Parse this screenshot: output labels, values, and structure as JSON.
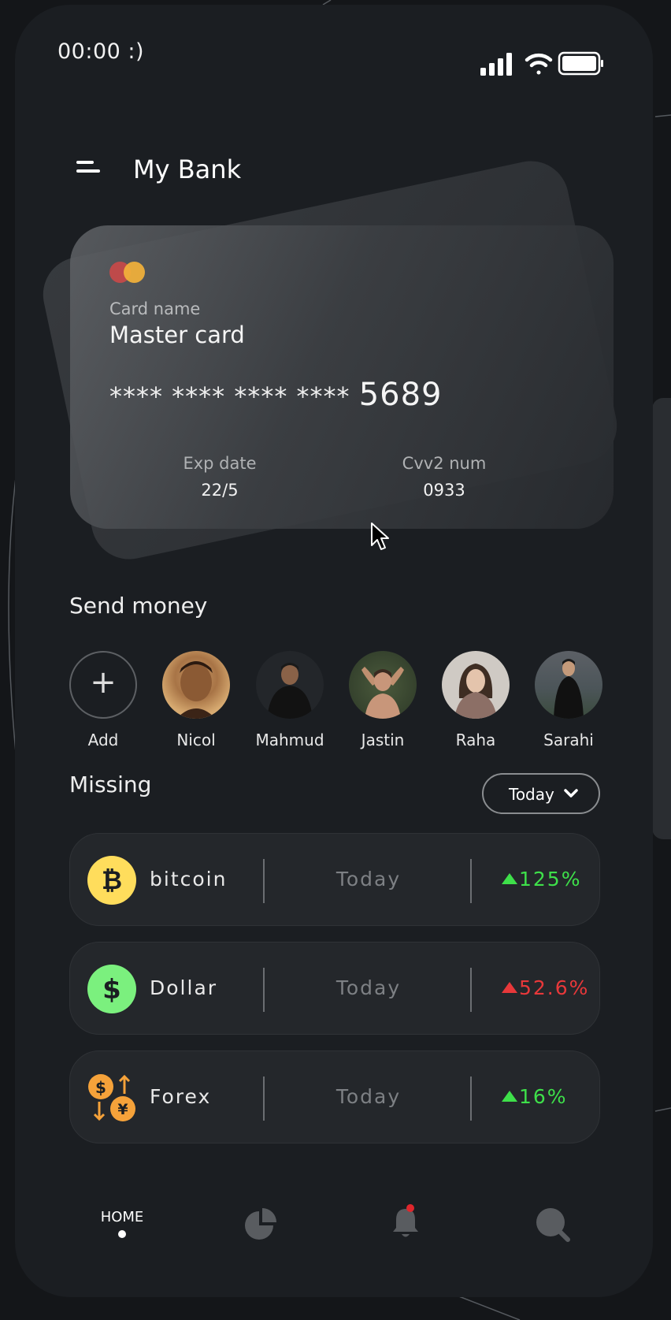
{
  "status_bar": {
    "time": "00:00 :)",
    "signal_icon": "signal-bars-icon",
    "wifi_icon": "wifi-icon",
    "battery_icon": "battery-full-icon"
  },
  "header": {
    "menu_icon": "menu-icon",
    "title": "My Bank"
  },
  "card": {
    "brand_icon": "mastercard-logo",
    "name_label": "Card name",
    "name_value": "Master card",
    "number_masked": "**** **** **** ****",
    "number_last4": "5689",
    "exp_label": "Exp date",
    "exp_value": "22/5",
    "cvv_label": "Cvv2 num",
    "cvv_value": "0933"
  },
  "send_money": {
    "title": "Send money",
    "contacts": [
      {
        "name": "Add",
        "icon": "plus-icon"
      },
      {
        "name": "Nicol"
      },
      {
        "name": "Mahmud"
      },
      {
        "name": "Jastin"
      },
      {
        "name": "Raha"
      },
      {
        "name": "Sarahi"
      }
    ]
  },
  "missing": {
    "title": "Missing",
    "filter_label": "Today",
    "rows": [
      {
        "name": "bitcoin",
        "icon": "bitcoin-icon",
        "period": "Today",
        "change": "125%",
        "color": "#3ee04a"
      },
      {
        "name": "Dollar",
        "icon": "dollar-icon",
        "period": "Today",
        "change": "52.6%",
        "color": "#e8383a"
      },
      {
        "name": "Forex",
        "icon": "forex-exchange-icon",
        "period": "Today",
        "change": "16%",
        "color": "#3ee04a"
      }
    ]
  },
  "bottom_nav": {
    "home_label": "HOME",
    "items": [
      "home",
      "pie-chart-icon",
      "bell-icon",
      "search-icon"
    ]
  },
  "colors": {
    "background": "#1b1e22",
    "positive": "#3ee04a",
    "negative": "#e8383a",
    "bitcoin": "#ffdd5c",
    "dollar": "#7bf07e",
    "forex": "#f5a23a"
  }
}
